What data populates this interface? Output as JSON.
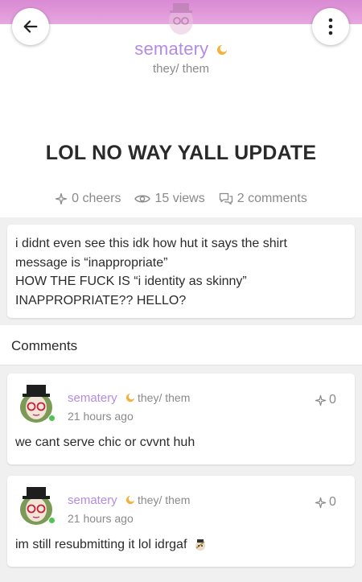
{
  "profile": {
    "username": "sematery",
    "pronouns": "they/ them"
  },
  "post": {
    "title": "LOL NO WAY YALL UPDATE",
    "stats": {
      "cheers": "0 cheers",
      "views": "15 views",
      "comments": "2 comments"
    },
    "body": "i didnt even see this idk how hut it says the shirt\nmessage is “inappropriate”\nHOW THE FUCK IS “i identity as skinny”\nINAPPROPRIATE?? HELLO?"
  },
  "comments_section": {
    "heading": "Comments",
    "items": [
      {
        "username": "sematery",
        "pronouns": "they/ them",
        "time": "21 hours ago",
        "cheers": "0",
        "text": "we cant serve chic or cvvnt huh"
      },
      {
        "username": "sematery",
        "pronouns": "they/ them",
        "time": "21 hours ago",
        "cheers": "0",
        "text": "im still resubmitting it lol idrgaf"
      }
    ]
  },
  "icons": {
    "back": "arrow-left-icon",
    "more": "more-vertical-icon",
    "cheer": "sparkle-icon",
    "views": "eye-icon",
    "comments": "comment-bubbles-icon",
    "badge": "moon-badge-icon"
  },
  "colors": {
    "accent": "#b48be3",
    "banner": "#d98ad3",
    "online": "#4fc451"
  }
}
